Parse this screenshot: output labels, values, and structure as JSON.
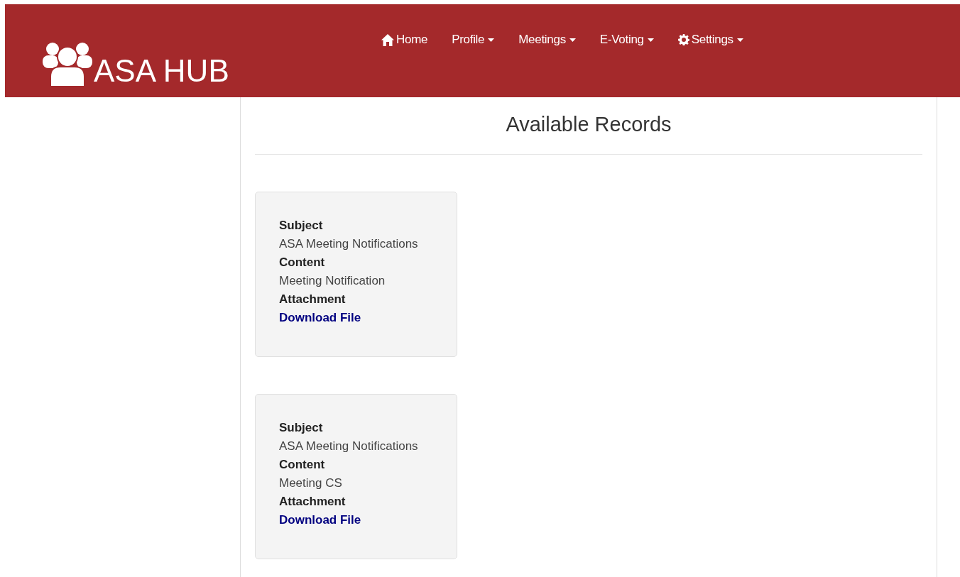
{
  "brand": {
    "title": "ASA HUB"
  },
  "nav": [
    {
      "label": "Home",
      "kind": "link"
    },
    {
      "label": "Profile",
      "kind": "dropdown"
    },
    {
      "label": "Meetings",
      "kind": "dropdown"
    },
    {
      "label": "E-Voting",
      "kind": "dropdown"
    },
    {
      "label": "Settings",
      "kind": "dropdown"
    }
  ],
  "page": {
    "title": "Available Records"
  },
  "records": [
    {
      "fields": [
        {
          "label": "Subject",
          "value": "ASA Meeting Notifications",
          "kind": "text"
        },
        {
          "label": "Content",
          "value": "Meeting Notification",
          "kind": "text"
        },
        {
          "label": "Attachment",
          "value": "Download File",
          "kind": "link"
        }
      ]
    },
    {
      "fields": [
        {
          "label": "Subject",
          "value": "ASA Meeting Notifications",
          "kind": "text"
        },
        {
          "label": "Content",
          "value": "Meeting CS",
          "kind": "text"
        },
        {
          "label": "Attachment",
          "value": "Download File",
          "kind": "link"
        }
      ]
    }
  ]
}
